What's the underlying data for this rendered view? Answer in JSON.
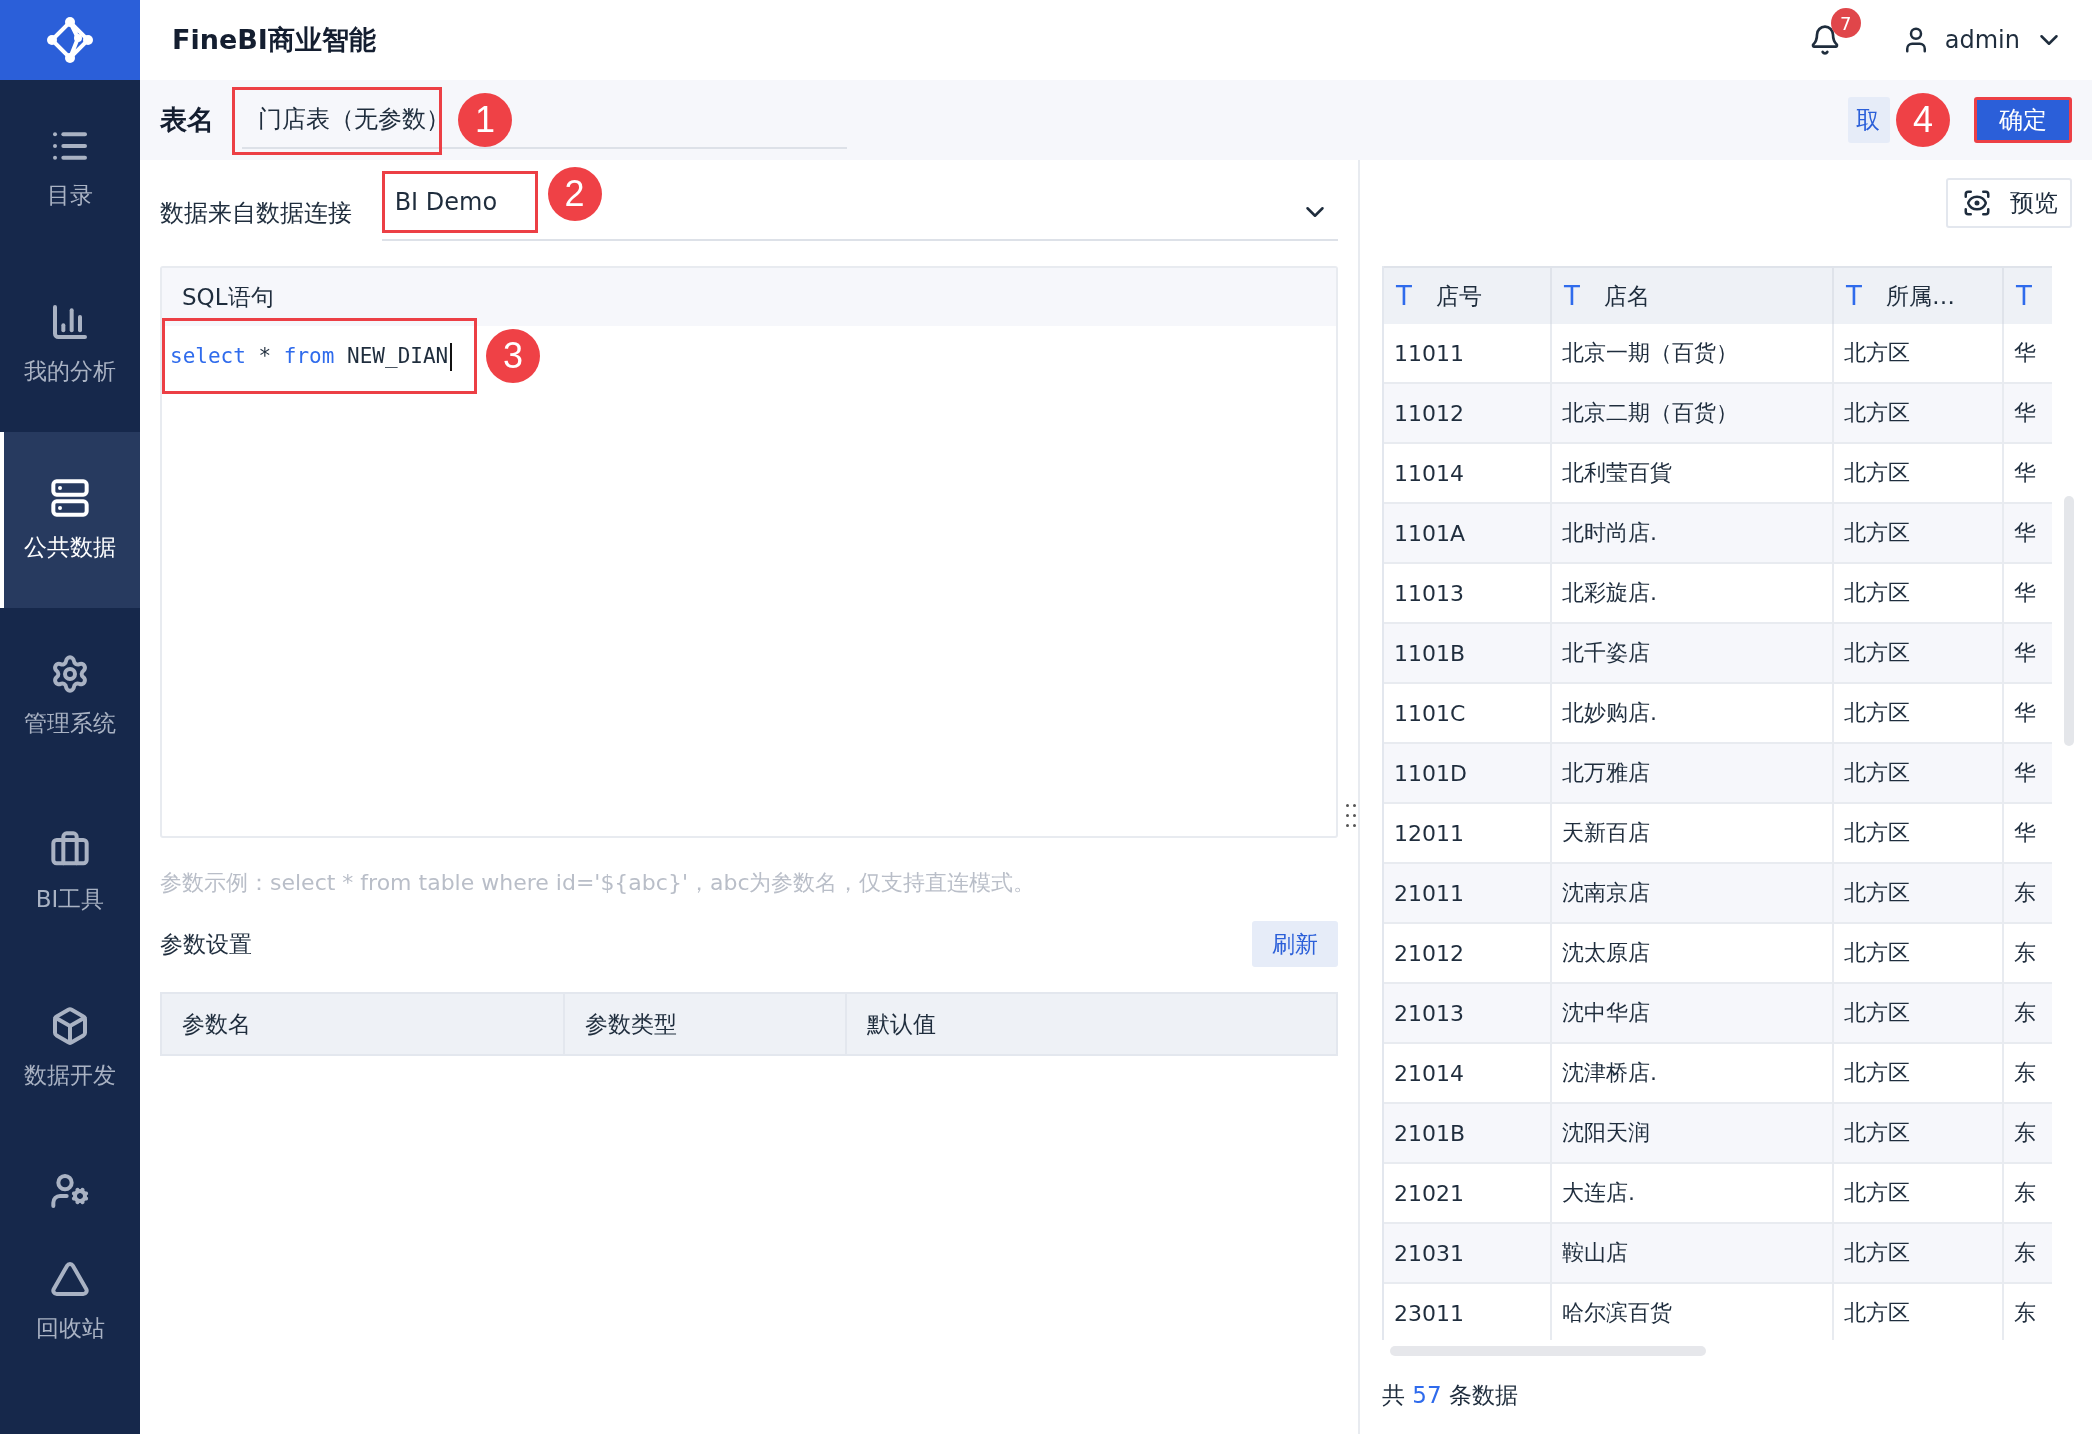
{
  "app": {
    "title": "FineBI商业智能",
    "notifications": "7",
    "user": "admin"
  },
  "sidebar": {
    "items": [
      {
        "label": "目录",
        "selected": false
      },
      {
        "label": "我的分析",
        "selected": false
      },
      {
        "label": "公共数据",
        "selected": true
      },
      {
        "label": "管理系统",
        "selected": false
      },
      {
        "label": "BI工具",
        "selected": false
      },
      {
        "label": "数据开发",
        "selected": false
      },
      {
        "selected": false
      },
      {
        "label": "回收站",
        "selected": false
      }
    ]
  },
  "table_name": {
    "label": "表名",
    "value": "门店表（无参数）",
    "callout": "1"
  },
  "actions": [
    {
      "kind": "secondary",
      "label": "取"
    },
    {
      "kind": "primary",
      "label": "确定",
      "callout": "4"
    }
  ],
  "connection": {
    "label": "数据来自数据连接",
    "value": "BI Demo",
    "callout": "2"
  },
  "sql": {
    "title": "SQL语句",
    "callout": "3",
    "tokens": [
      {
        "kind": "keyword",
        "text": "select"
      },
      {
        "kind": "plain",
        "text": "*"
      },
      {
        "kind": "keyword",
        "text": "from"
      },
      {
        "kind": "plain",
        "text": "NEW_DIAN"
      }
    ]
  },
  "hint": "参数示例：select * from table where id='${abc}'，abc为参数名，仅支持直连模式。",
  "params": {
    "title": "参数设置",
    "refresh": "刷新",
    "columns": [
      "参数名",
      "参数类型",
      "默认值"
    ]
  },
  "preview": {
    "button": "预览",
    "columns": [
      {
        "type_mark": "T",
        "label": "店号"
      },
      {
        "type_mark": "T",
        "label": "店名"
      },
      {
        "type_mark": "T",
        "label": "所属…"
      },
      {
        "type_mark": "T"
      }
    ],
    "rows": [
      [
        "11011",
        "北京一期（百货）",
        "北方区",
        "华"
      ],
      [
        "11012",
        "北京二期（百货）",
        "北方区",
        "华"
      ],
      [
        "11014",
        "北利莹百貨",
        "北方区",
        "华"
      ],
      [
        "1101A",
        "北时尚店.",
        "北方区",
        "华"
      ],
      [
        "11013",
        "北彩旋店.",
        "北方区",
        "华"
      ],
      [
        "1101B",
        "北千姿店",
        "北方区",
        "华"
      ],
      [
        "1101C",
        "北妙购店.",
        "北方区",
        "华"
      ],
      [
        "1101D",
        "北万雅店",
        "北方区",
        "华"
      ],
      [
        "12011",
        "天新百店",
        "北方区",
        "华"
      ],
      [
        "21011",
        "沈南京店",
        "北方区",
        "东"
      ],
      [
        "21012",
        "沈太原店",
        "北方区",
        "东"
      ],
      [
        "21013",
        "沈中华店",
        "北方区",
        "东"
      ],
      [
        "21014",
        "沈津桥店.",
        "北方区",
        "东"
      ],
      [
        "2101B",
        "沈阳天润",
        "北方区",
        "东"
      ],
      [
        "21021",
        "大连店.",
        "北方区",
        "东"
      ],
      [
        "21031",
        "鞍山店",
        "北方区",
        "东"
      ],
      [
        "23011",
        "哈尔滨百货",
        "北方区",
        "东"
      ]
    ],
    "total_prefix": "共",
    "total": "57",
    "total_suffix": "条数据"
  }
}
